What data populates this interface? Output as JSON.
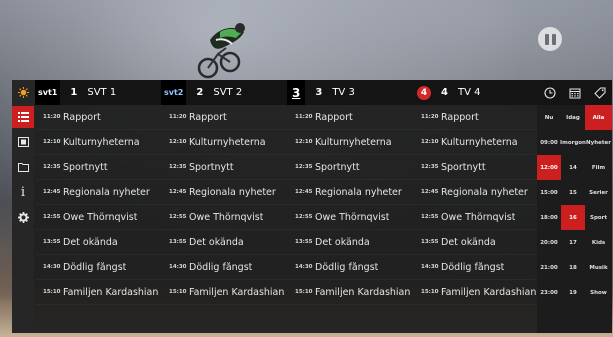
{
  "colors": {
    "accent": "#cc1f1f",
    "panel": "#1e1e1e",
    "header": "#141414",
    "text": "#e6e6e6"
  },
  "sidebar": {
    "items": [
      {
        "icon": "sun-icon"
      },
      {
        "icon": "grid-list-icon",
        "active": true
      },
      {
        "icon": "film-icon"
      },
      {
        "icon": "folder-icon"
      },
      {
        "icon": "info-icon",
        "glyph": "i"
      },
      {
        "icon": "gear-icon"
      }
    ]
  },
  "channels": [
    {
      "logo": "svt1",
      "number": "1",
      "name": "SVT 1",
      "programs": [
        {
          "time": "11:20",
          "title": "Rapport"
        },
        {
          "time": "12:10",
          "title": "Kulturnyheterna"
        },
        {
          "time": "12:35",
          "title": "Sportnytt"
        },
        {
          "time": "12:45",
          "title": "Regionala nyheter"
        },
        {
          "time": "12:55",
          "title": "Owe Thörnqvist"
        },
        {
          "time": "13:55",
          "title": "Det okända"
        },
        {
          "time": "14:30",
          "title": "Dödlig fångst"
        },
        {
          "time": "15:10",
          "title": "Familjen Kardashian"
        }
      ]
    },
    {
      "logo": "svt2",
      "number": "2",
      "name": "SVT 2",
      "programs": [
        {
          "time": "11:20",
          "title": "Rapport"
        },
        {
          "time": "12:10",
          "title": "Kulturnyheterna"
        },
        {
          "time": "12:35",
          "title": "Sportnytt"
        },
        {
          "time": "12:45",
          "title": "Regionala nyheter"
        },
        {
          "time": "12:55",
          "title": "Owe Thörnqvist"
        },
        {
          "time": "13:55",
          "title": "Det okända"
        },
        {
          "time": "14:30",
          "title": "Dödlig fångst"
        },
        {
          "time": "15:10",
          "title": "Familjen Kardashian"
        }
      ]
    },
    {
      "logo": "3",
      "number": "3",
      "name": "TV 3",
      "programs": [
        {
          "time": "11:20",
          "title": "Rapport"
        },
        {
          "time": "12:10",
          "title": "Kulturnyheterna"
        },
        {
          "time": "12:35",
          "title": "Sportnytt"
        },
        {
          "time": "12:45",
          "title": "Regionala nyheter"
        },
        {
          "time": "12:55",
          "title": "Owe Thörnqvist"
        },
        {
          "time": "13:55",
          "title": "Det okända"
        },
        {
          "time": "14:30",
          "title": "Dödlig fångst"
        },
        {
          "time": "15:10",
          "title": "Familjen Kardashian"
        }
      ]
    },
    {
      "logo": "4",
      "number": "4",
      "name": "TV 4",
      "programs": [
        {
          "time": "11:20",
          "title": "Rapport"
        },
        {
          "time": "12:10",
          "title": "Kulturnyheterna"
        },
        {
          "time": "12:35",
          "title": "Sportnytt"
        },
        {
          "time": "12:45",
          "title": "Regionala nyheter"
        },
        {
          "time": "12:55",
          "title": "Owe Thörnqvist"
        },
        {
          "time": "13:55",
          "title": "Det okända"
        },
        {
          "time": "14:30",
          "title": "Dödlig fångst"
        },
        {
          "time": "15:10",
          "title": "Familjen Kardashian"
        }
      ]
    }
  ],
  "filters": {
    "header_icons": [
      "clock-icon",
      "calendar-icon",
      "tag-icon"
    ],
    "rows": [
      {
        "time": "Nu",
        "day": "Idag",
        "category": "Alla",
        "category_selected": true
      },
      {
        "time": "09:00",
        "day": "Imorgon",
        "category": "Nyheter"
      },
      {
        "time": "12:00",
        "day": "14",
        "category": "Film",
        "time_selected": true
      },
      {
        "time": "15:00",
        "day": "15",
        "category": "Serier"
      },
      {
        "time": "18:00",
        "day": "16",
        "category": "Sport",
        "day_selected": true
      },
      {
        "time": "20:00",
        "day": "17",
        "category": "Kids"
      },
      {
        "time": "21:00",
        "day": "18",
        "category": "Musik"
      },
      {
        "time": "23:00",
        "day": "19",
        "category": "Show"
      }
    ]
  }
}
